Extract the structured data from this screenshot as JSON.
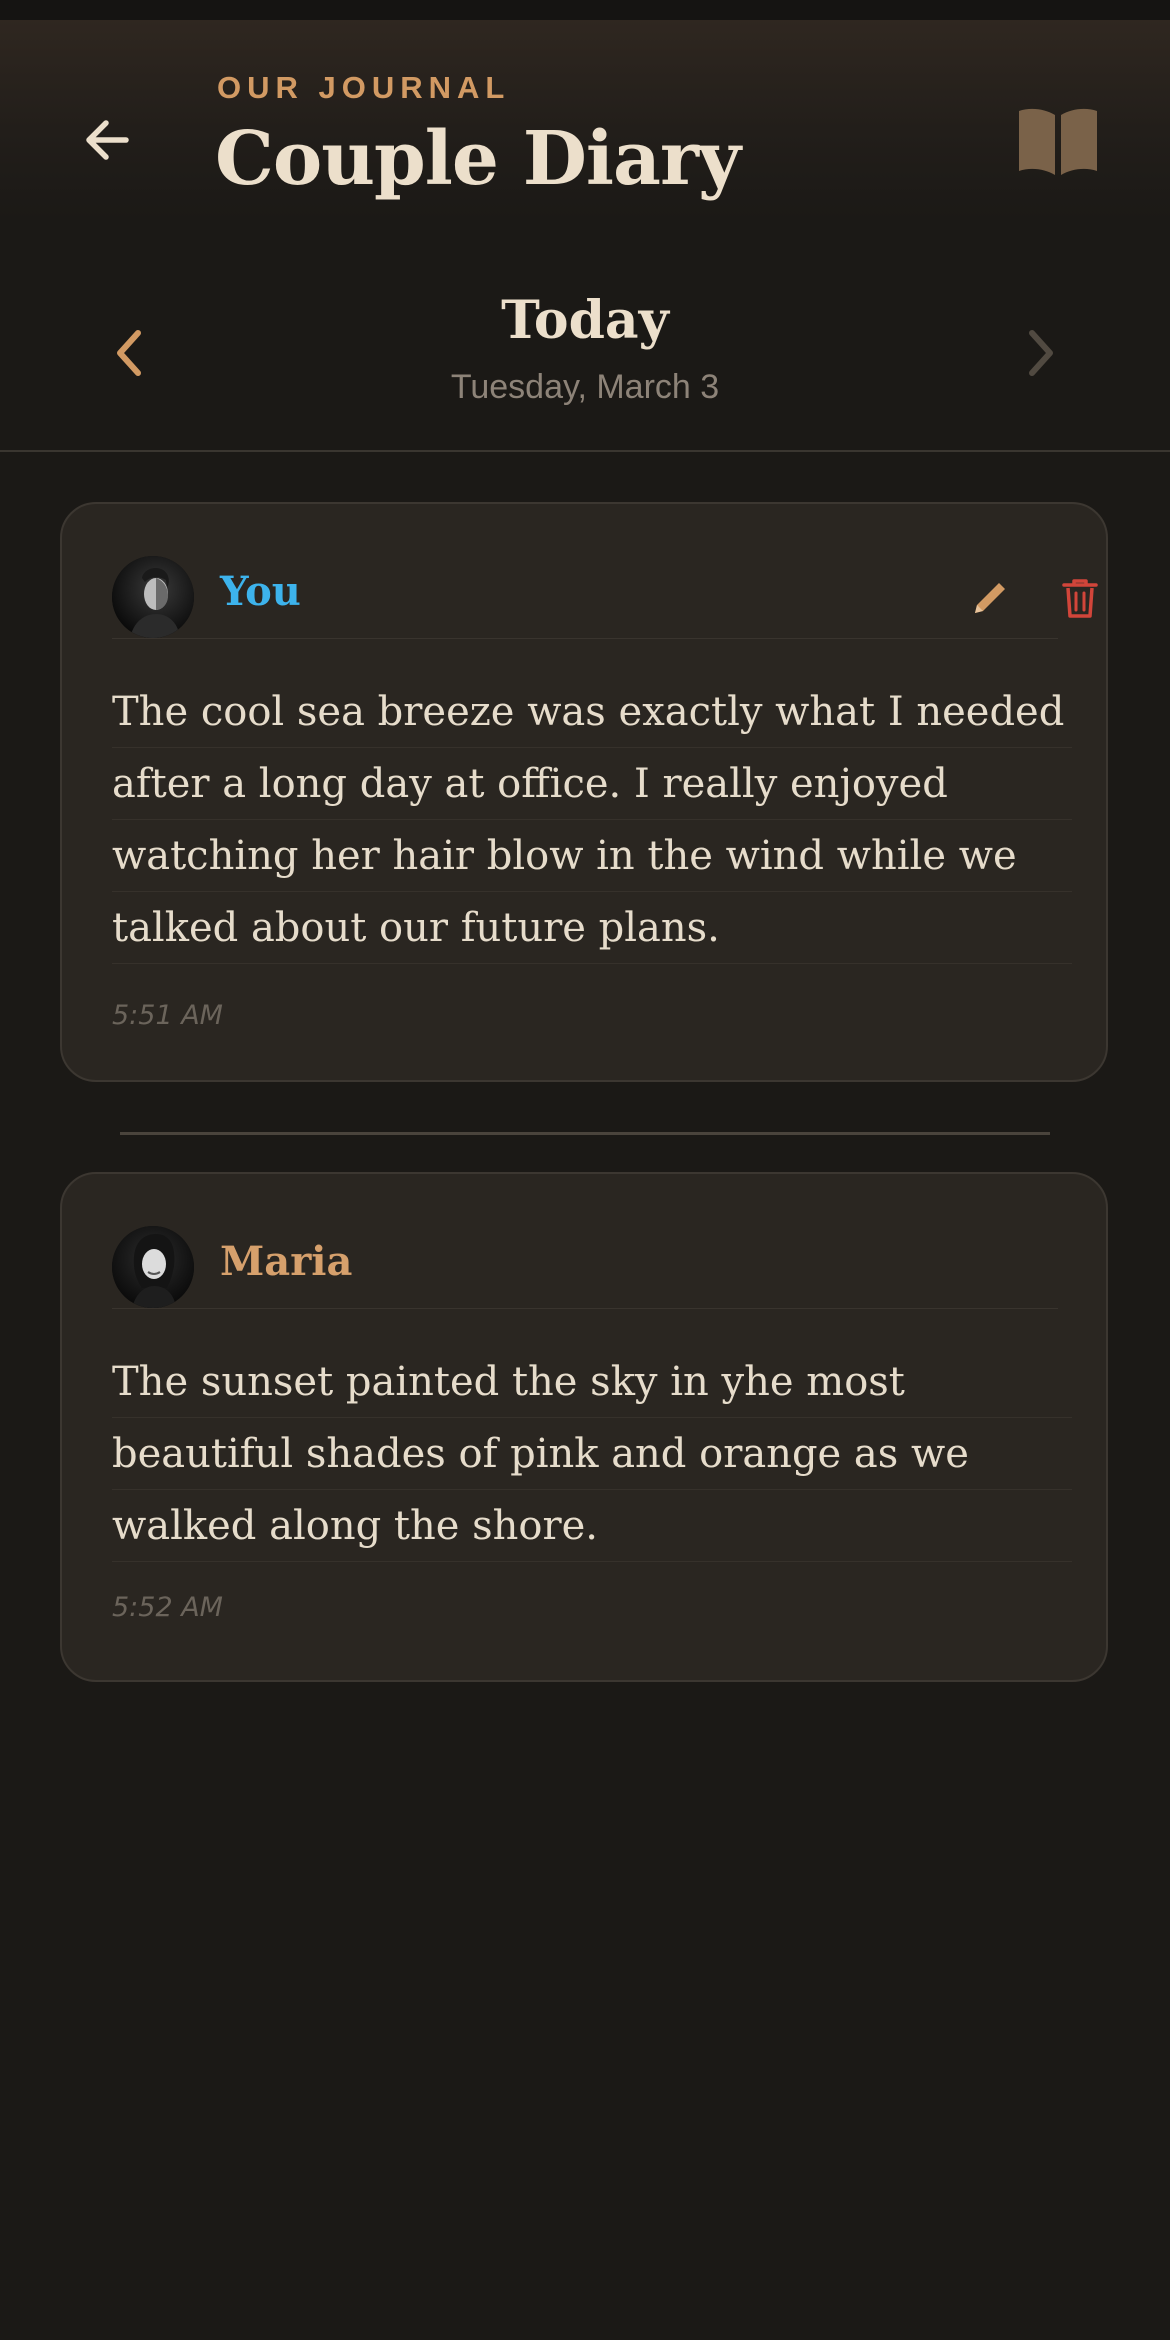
{
  "header": {
    "eyebrow": "OUR JOURNAL",
    "title": "Couple Diary",
    "back_icon": "arrow-left-icon",
    "journal_icon": "open-book-icon"
  },
  "date_nav": {
    "title": "Today",
    "subtitle": "Tuesday, March 3",
    "prev_icon": "chevron-left-icon",
    "next_icon": "chevron-right-icon"
  },
  "entries": [
    {
      "author": "You",
      "text": "The cool sea breeze was exactly what I needed after a long day at office. I really enjoyed watching her hair blow in the wind while we talked about our future plans.",
      "time": "5:51 AM",
      "author_color": "#3db3ec",
      "editable": true
    },
    {
      "author": "Maria",
      "text": "The sunset painted the sky in yhe most beautiful shades of pink and orange as we walked along the shore.",
      "time": "5:52 AM",
      "author_color": "#d6a06c",
      "editable": false
    }
  ],
  "colors": {
    "background": "#1b1916",
    "card": "#2a2621",
    "accent": "#d29a63",
    "delete": "#d2453a",
    "text": "#e6dccb"
  }
}
